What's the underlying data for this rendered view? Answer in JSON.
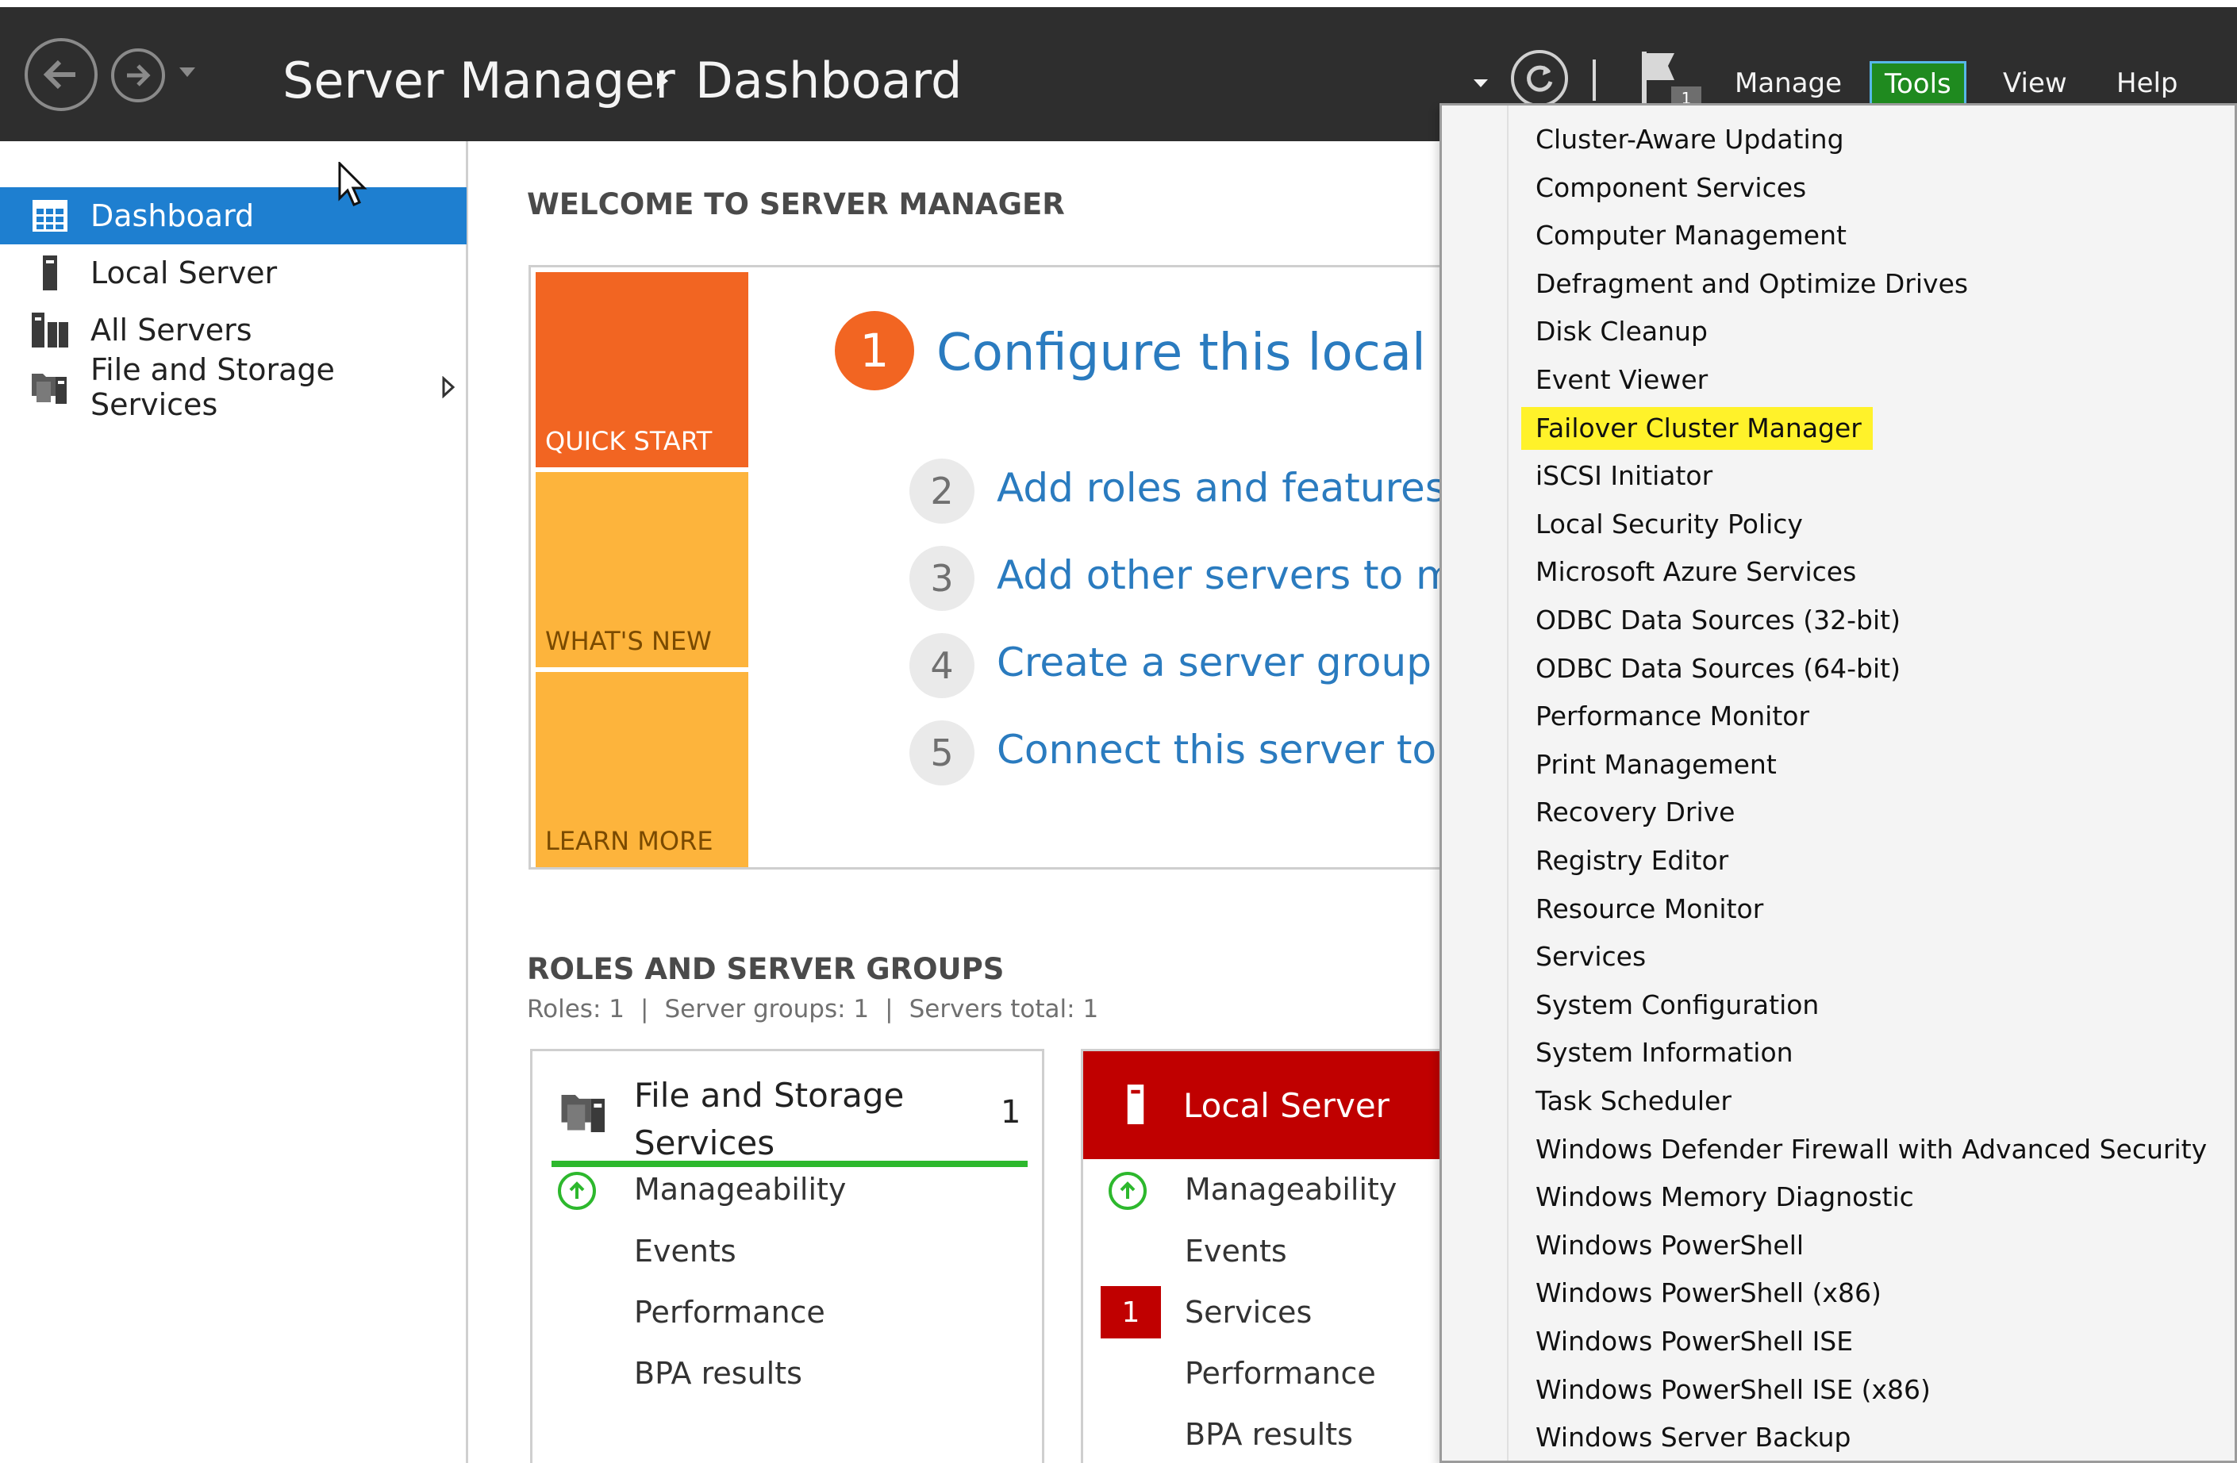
{
  "window": {
    "app_title": "Server Manager",
    "separator_glyph": "▸",
    "page_title": "Dashboard",
    "menu": {
      "manage": "Manage",
      "tools": "Tools",
      "view": "View",
      "help": "Help"
    },
    "notification_count": "1"
  },
  "sidebar": {
    "items": [
      {
        "label": "Dashboard",
        "icon": "dashboard-icon",
        "active": true
      },
      {
        "label": "Local Server",
        "icon": "server-icon",
        "active": false
      },
      {
        "label": "All Servers",
        "icon": "servers-icon",
        "active": false
      },
      {
        "label": "File and Storage Services",
        "icon": "file-storage-icon",
        "active": false
      }
    ]
  },
  "welcome": {
    "heading": "WELCOME TO SERVER MANAGER",
    "tiles": {
      "quick_start": "QUICK START",
      "whats_new": "WHAT'S NEW",
      "learn_more": "LEARN MORE"
    },
    "steps": [
      {
        "num": "1",
        "text": "Configure this local ser"
      },
      {
        "num": "2",
        "text": "Add roles and features"
      },
      {
        "num": "3",
        "text": "Add other servers to man"
      },
      {
        "num": "4",
        "text": "Create a server group"
      },
      {
        "num": "5",
        "text": "Connect this server to clou"
      }
    ]
  },
  "roles": {
    "heading": "ROLES AND SERVER GROUPS",
    "stats": {
      "roles": "Roles: 1",
      "groups": "Server groups: 1",
      "total": "Servers total: 1",
      "sep": "|"
    },
    "cards": {
      "file_storage": {
        "title": "File and Storage Services",
        "count": "1",
        "rows": [
          "Manageability",
          "Events",
          "Performance",
          "BPA results"
        ]
      },
      "local_server": {
        "title": "Local Server",
        "services_badge": "1",
        "rows": [
          "Manageability",
          "Events",
          "Services",
          "Performance",
          "BPA results"
        ]
      }
    }
  },
  "tools_menu": {
    "highlighted": "Failover Cluster Manager",
    "items": [
      "Cluster-Aware Updating",
      "Component Services",
      "Computer Management",
      "Defragment and Optimize Drives",
      "Disk Cleanup",
      "Event Viewer",
      "Failover Cluster Manager",
      "iSCSI Initiator",
      "Local Security Policy",
      "Microsoft Azure Services",
      "ODBC Data Sources (32-bit)",
      "ODBC Data Sources (64-bit)",
      "Performance Monitor",
      "Print Management",
      "Recovery Drive",
      "Registry Editor",
      "Resource Monitor",
      "Services",
      "System Configuration",
      "System Information",
      "Task Scheduler",
      "Windows Defender Firewall with Advanced Security",
      "Windows Memory Diagnostic",
      "Windows PowerShell",
      "Windows PowerShell (x86)",
      "Windows PowerShell ISE",
      "Windows PowerShell ISE (x86)",
      "Windows Server Backup"
    ]
  },
  "colors": {
    "titlebar": "#2e2e2e",
    "sidebar_active": "#1e7fd0",
    "quick_start_tile": "#f26522",
    "tile_yellow": "#fdb43c",
    "link_blue": "#2a7bbf",
    "highlight_yellow": "#fff22a",
    "status_green": "#2db82d",
    "alert_red": "#c00000"
  }
}
